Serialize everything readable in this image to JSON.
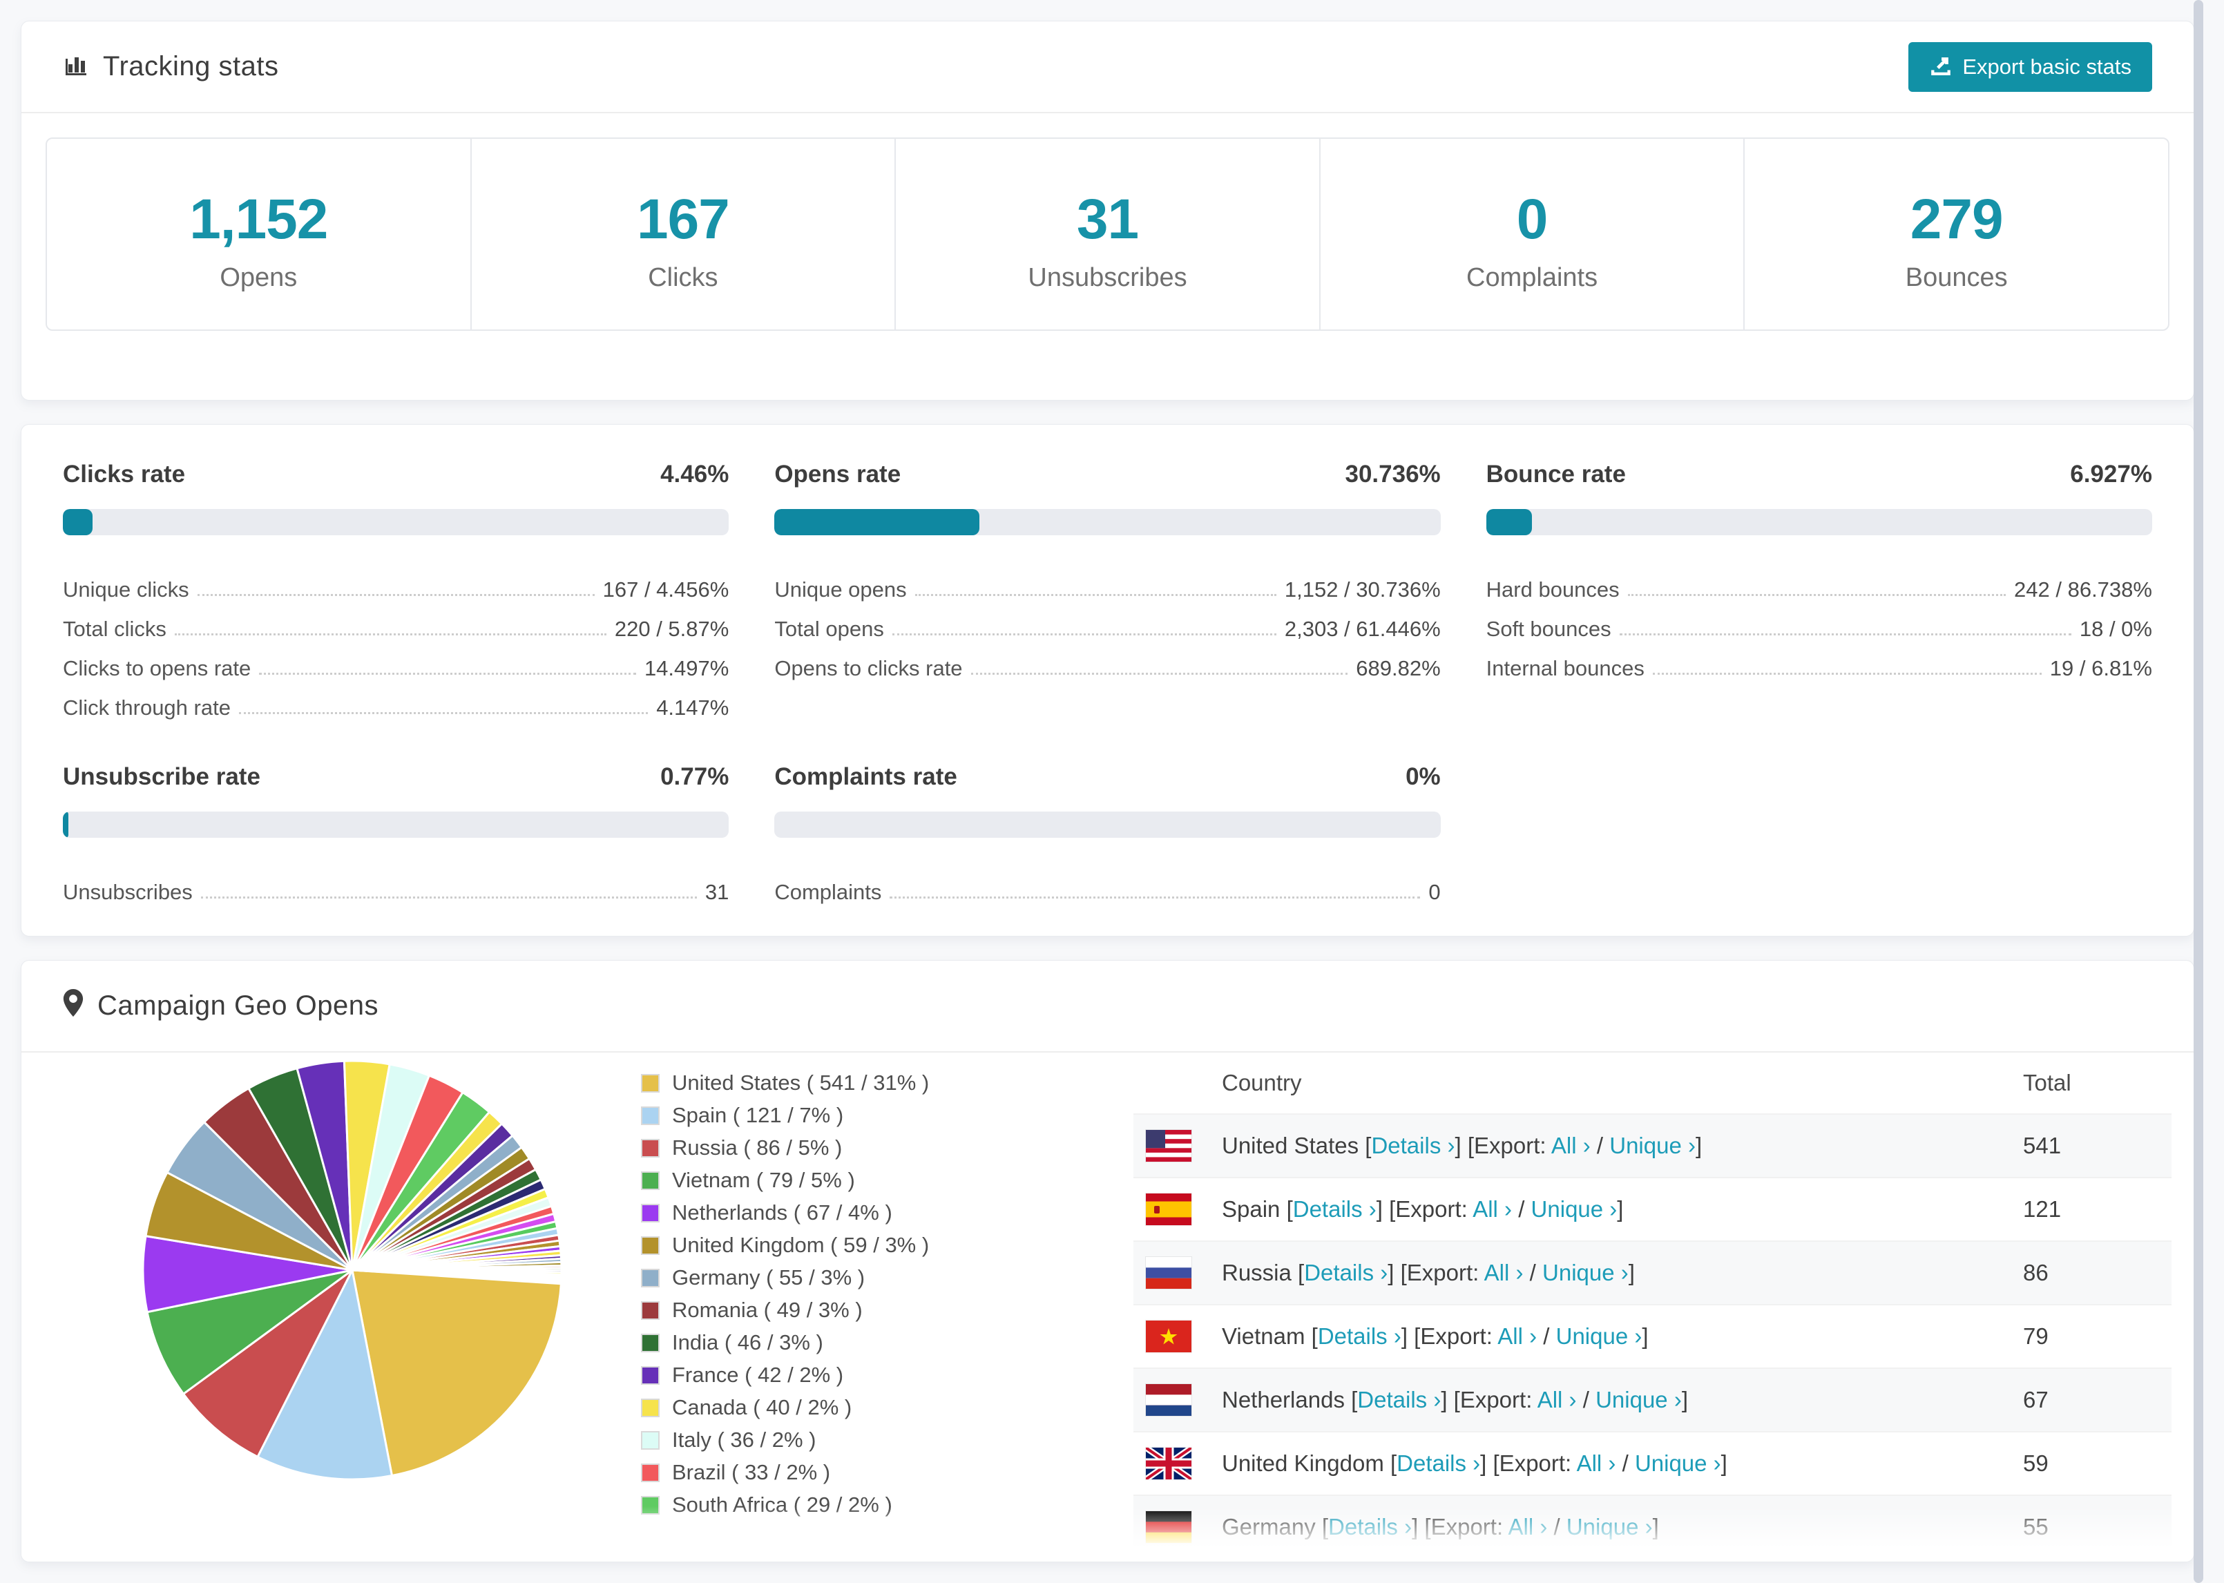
{
  "colors": {
    "accent": "#1792a8",
    "bar_fill": "#0f88a1",
    "link": "#1d9cb8",
    "button_bg": "#1191a6"
  },
  "tracking_card": {
    "icon": "bar-chart-icon",
    "title": "Tracking stats",
    "export_button": {
      "icon": "export-icon",
      "label": "Export basic stats"
    },
    "stats": [
      {
        "value": "1,152",
        "label": "Opens"
      },
      {
        "value": "167",
        "label": "Clicks"
      },
      {
        "value": "31",
        "label": "Unsubscribes"
      },
      {
        "value": "0",
        "label": "Complaints"
      },
      {
        "value": "279",
        "label": "Bounces"
      }
    ]
  },
  "rate_panels": [
    {
      "title": "Clicks rate",
      "value": "4.46%",
      "percent": 4.46,
      "rows": [
        {
          "label": "Unique clicks",
          "value": "167 / 4.456%"
        },
        {
          "label": "Total clicks",
          "value": "220 / 5.87%"
        },
        {
          "label": "Clicks to opens rate",
          "value": "14.497%"
        },
        {
          "label": "Click through rate",
          "value": "4.147%"
        }
      ]
    },
    {
      "title": "Opens rate",
      "value": "30.736%",
      "percent": 30.736,
      "rows": [
        {
          "label": "Unique opens",
          "value": "1,152 / 30.736%"
        },
        {
          "label": "Total opens",
          "value": "2,303 / 61.446%"
        },
        {
          "label": "Opens to clicks rate",
          "value": "689.82%"
        }
      ]
    },
    {
      "title": "Bounce rate",
      "value": "6.927%",
      "percent": 6.927,
      "rows": [
        {
          "label": "Hard bounces",
          "value": "242 / 86.738%"
        },
        {
          "label": "Soft bounces",
          "value": "18 / 0%"
        },
        {
          "label": "Internal bounces",
          "value": "19 / 6.81%"
        }
      ]
    },
    {
      "title": "Unsubscribe rate",
      "value": "0.77%",
      "percent": 0.77,
      "rows": [
        {
          "label": "Unsubscribes",
          "value": "31"
        }
      ]
    },
    {
      "title": "Complaints rate",
      "value": "0%",
      "percent": 0,
      "rows": [
        {
          "label": "Complaints",
          "value": "0"
        }
      ]
    }
  ],
  "geo_card": {
    "icon": "map-pin-icon",
    "title": "Campaign Geo Opens",
    "table": {
      "columns": [
        "Country",
        "Total"
      ],
      "details_label": "Details ›",
      "export_label": "Export:",
      "all_label": "All ›",
      "unique_label": "Unique ›",
      "rows": [
        {
          "flag": "us",
          "country": "United States",
          "total": "541"
        },
        {
          "flag": "es",
          "country": "Spain",
          "total": "121"
        },
        {
          "flag": "ru",
          "country": "Russia",
          "total": "86"
        },
        {
          "flag": "vn",
          "country": "Vietnam",
          "total": "79"
        },
        {
          "flag": "nl",
          "country": "Netherlands",
          "total": "67"
        },
        {
          "flag": "gb",
          "country": "United Kingdom",
          "total": "59"
        },
        {
          "flag": "de",
          "country": "Germany",
          "total": "55"
        }
      ]
    }
  },
  "chart_data": {
    "type": "pie",
    "title": "Campaign Geo Opens",
    "total": 1152,
    "legend_position": "right",
    "series": [
      {
        "name": "United States",
        "value": 541,
        "pct": "31%",
        "color": "#e5c04a"
      },
      {
        "name": "Spain",
        "value": 121,
        "pct": "7%",
        "color": "#abd3f1"
      },
      {
        "name": "Russia",
        "value": 86,
        "pct": "5%",
        "color": "#c94d4f"
      },
      {
        "name": "Vietnam",
        "value": 79,
        "pct": "5%",
        "color": "#4caf50"
      },
      {
        "name": "Netherlands",
        "value": 67,
        "pct": "4%",
        "color": "#9b3af0"
      },
      {
        "name": "United Kingdom",
        "value": 59,
        "pct": "3%",
        "color": "#b3922c"
      },
      {
        "name": "Germany",
        "value": 55,
        "pct": "3%",
        "color": "#8fafc9"
      },
      {
        "name": "Romania",
        "value": 49,
        "pct": "3%",
        "color": "#9c3a3c"
      },
      {
        "name": "India",
        "value": 46,
        "pct": "3%",
        "color": "#2f7134"
      },
      {
        "name": "France",
        "value": 42,
        "pct": "2%",
        "color": "#6630b8"
      },
      {
        "name": "Canada",
        "value": 40,
        "pct": "2%",
        "color": "#f6e34c"
      },
      {
        "name": "Italy",
        "value": 36,
        "pct": "2%",
        "color": "#dcfcf6"
      },
      {
        "name": "Brazil",
        "value": 33,
        "pct": "2%",
        "color": "#f2595c"
      },
      {
        "name": "South Africa",
        "value": 29,
        "pct": "2%",
        "color": "#5fcb62"
      }
    ],
    "others_values": [
      15,
      14,
      13,
      12,
      11,
      10,
      9,
      8,
      8,
      7,
      7,
      6,
      6,
      5,
      5,
      4,
      4,
      3,
      3,
      3,
      2,
      2,
      2,
      2,
      1,
      1,
      1,
      1,
      1,
      1,
      1,
      1
    ],
    "others_palette": [
      "#f6e34c",
      "#5a2da0",
      "#8fafc9",
      "#a08a26",
      "#9c3a3c",
      "#2f7134",
      "#2b2a72",
      "#f5ef49",
      "#e5fbf6",
      "#f2595c",
      "#d44cf0",
      "#57cb5e",
      "#abd3f1",
      "#c94d4f",
      "#b3922c",
      "#9b3af0"
    ]
  }
}
